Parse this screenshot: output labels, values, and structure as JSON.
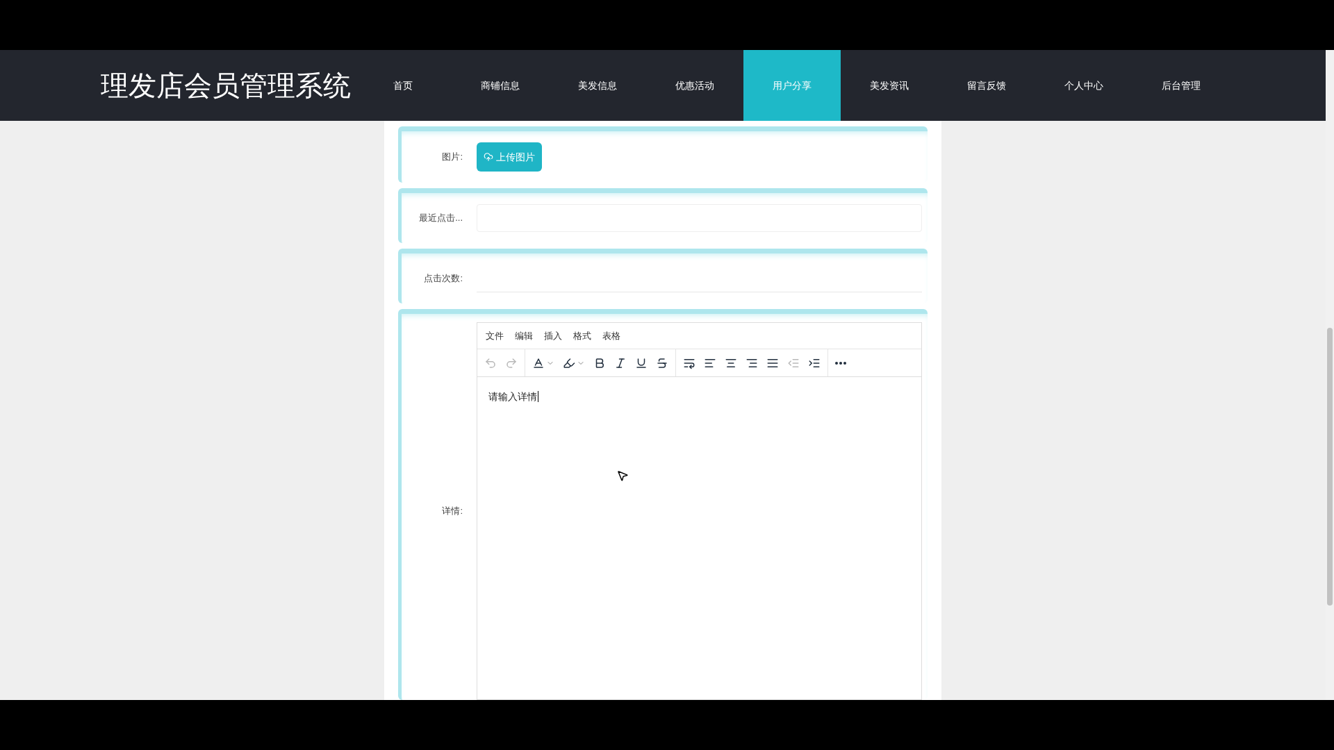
{
  "header": {
    "title": "理发店会员管理系统"
  },
  "nav": [
    {
      "label": "首页",
      "selected": false
    },
    {
      "label": "商铺信息",
      "selected": false
    },
    {
      "label": "美发信息",
      "selected": false
    },
    {
      "label": "优惠活动",
      "selected": false
    },
    {
      "label": "用户分享",
      "selected": true
    },
    {
      "label": "美发资讯",
      "selected": false
    },
    {
      "label": "留言反馈",
      "selected": false
    },
    {
      "label": "个人中心",
      "selected": false
    },
    {
      "label": "后台管理",
      "selected": false
    }
  ],
  "form": [
    {
      "kind": "upload",
      "label": "图片:",
      "button": "上传图片"
    },
    {
      "kind": "input",
      "label": "最近点击..."
    },
    {
      "kind": "underline",
      "label": "点击次数:"
    },
    {
      "kind": "editor",
      "label": "详情:",
      "menu": [
        "文件",
        "编辑",
        "插入",
        "格式",
        "表格"
      ],
      "toolbar": [
        [
          {
            "kind": "undo",
            "disabled": true
          },
          {
            "kind": "redo",
            "disabled": true
          }
        ],
        [
          {
            "kind": "text-color",
            "disabled": false
          },
          {
            "kind": "highlight",
            "disabled": false
          },
          {
            "kind": "bold",
            "disabled": false
          },
          {
            "kind": "italic",
            "disabled": false
          },
          {
            "kind": "underline",
            "disabled": false
          },
          {
            "kind": "strikethrough",
            "disabled": false
          }
        ],
        [
          {
            "kind": "line-height",
            "disabled": false
          },
          {
            "kind": "align-left",
            "disabled": false
          },
          {
            "kind": "align-center",
            "disabled": false
          },
          {
            "kind": "align-right",
            "disabled": false
          },
          {
            "kind": "justify",
            "disabled": false
          },
          {
            "kind": "outdent",
            "disabled": true
          },
          {
            "kind": "indent",
            "disabled": false
          }
        ],
        [
          {
            "kind": "more",
            "disabled": false
          }
        ]
      ],
      "content": "请输入详情"
    }
  ]
}
